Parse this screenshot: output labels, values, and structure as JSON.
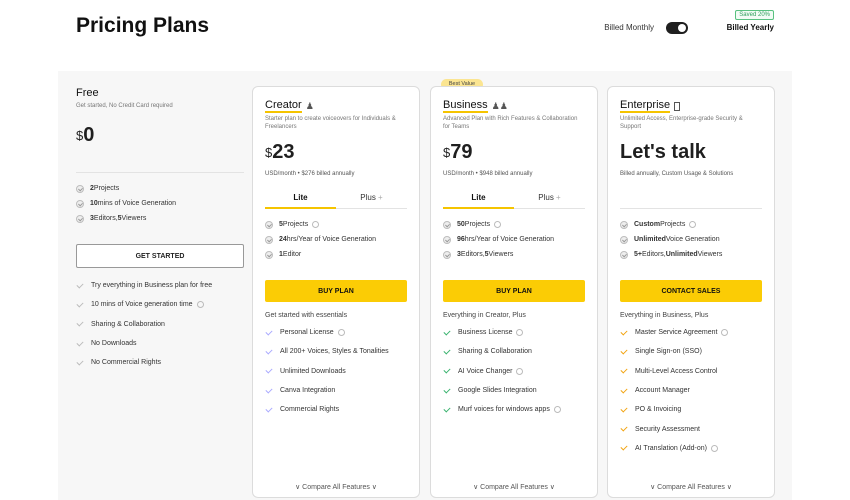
{
  "page": {
    "title": "Pricing Plans"
  },
  "billing": {
    "monthly": "Billed Monthly",
    "yearly": "Billed Yearly",
    "saved": "Saved 20%"
  },
  "free": {
    "name": "Free",
    "desc": "Get started, No Credit Card required",
    "currency": "$",
    "price": "0",
    "quota": [
      {
        "bold": "2",
        "text": " Projects"
      },
      {
        "bold": "10",
        "text": " mins of Voice Generation"
      },
      {
        "bold": "3",
        "text": " Editors, ",
        "bold2": "5",
        "text2": " Viewers"
      }
    ],
    "cta": "GET STARTED",
    "features": [
      "Try everything in Business plan for free",
      "10 mins of Voice generation time",
      "Sharing & Collaboration",
      "No Downloads",
      "No Commercial Rights"
    ]
  },
  "creator": {
    "name": "Creator",
    "desc": "Starter plan to create voiceovers for Individuals & Freelancers",
    "currency": "$",
    "price": "23",
    "note": "USD/month  •  $276 billed annually",
    "tabs": [
      "Lite",
      "Plus"
    ],
    "quota": [
      {
        "bold": "5",
        "text": " Projects"
      },
      {
        "bold": "24",
        "text": " hrs/Year of Voice Generation"
      },
      {
        "bold": "1",
        "text": " Editor"
      }
    ],
    "cta": "BUY PLAN",
    "lead": "Get started with essentials",
    "features": [
      "Personal License",
      "All 200+ Voices, Styles & Tonalities",
      "Unlimited Downloads",
      "Canva Integration",
      "Commercial Rights"
    ],
    "compare": "Compare All Features"
  },
  "business": {
    "badge": "Best Value",
    "name": "Business",
    "desc": "Advanced Plan with Rich Features & Collaboration for Teams",
    "currency": "$",
    "price": "79",
    "note": "USD/month  •  $948 billed annually",
    "tabs": [
      "Lite",
      "Plus"
    ],
    "quota": [
      {
        "bold": "50",
        "text": " Projects"
      },
      {
        "bold": "96",
        "text": " hrs/Year of Voice Generation"
      },
      {
        "bold": "3",
        "text": " Editors, ",
        "bold2": "5",
        "text2": " Viewers"
      }
    ],
    "cta": "BUY PLAN",
    "lead": "Everything in Creator, Plus",
    "features": [
      "Business License",
      "Sharing & Collaboration",
      "AI Voice Changer",
      "Google Slides Integration",
      "Murf voices for windows apps"
    ],
    "compare": "Compare All Features"
  },
  "enterprise": {
    "name": "Enterprise",
    "desc": "Unlimited Access, Enterprise-grade Security & Support",
    "price": "Let's talk",
    "note": "Billed annually, Custom Usage & Solutions",
    "quota": [
      {
        "bold": "Custom",
        "text": " Projects"
      },
      {
        "bold": "Unlimited",
        "text": " Voice Generation"
      },
      {
        "bold": "5+",
        "text": " Editors, ",
        "bold2": "Unlimited",
        "text2": " Viewers"
      }
    ],
    "cta": "CONTACT SALES",
    "lead": "Everything in Business, Plus",
    "features": [
      "Master Service Agreement",
      "Single Sign-on (SSO)",
      "Multi-Level Access Control",
      "Account Manager",
      "PO & Invoicing",
      "Security Assessment",
      "AI Translation (Add-on)"
    ],
    "compare": "Compare All Features"
  }
}
